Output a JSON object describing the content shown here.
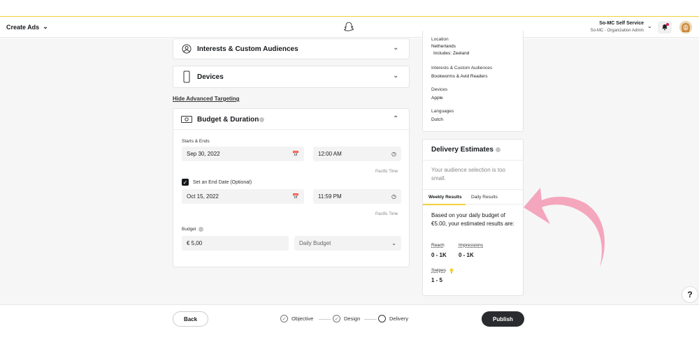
{
  "header": {
    "menu_label": "Create Ads",
    "account_name": "So-MC Self Service",
    "account_sub": "So-MC - Organization Admin"
  },
  "targeting": {
    "interests_title": "Interests & Custom Audiences",
    "devices_title": "Devices",
    "hide_link": "Hide Advanced Targeting"
  },
  "budget": {
    "title": "Budget & Duration",
    "starts_label": "Starts & Ends",
    "start_date": "Sep 30, 2022",
    "start_time": "12:00 AM",
    "timezone": "Pacific Time",
    "end_checkbox_label": "Set an End Date (Optional)",
    "end_date": "Oct 15, 2022",
    "end_time": "11:59 PM",
    "budget_label": "Budget",
    "budget_value": "€ 5,00",
    "budget_type": "Daily Budget"
  },
  "summary": {
    "location_label": "Location",
    "location_value": "Netherlands",
    "location_includes": "Includes: Zeeland",
    "interests_label": "Interests & Custom Audiences",
    "interests_value": "Bookworms & Avid Readers",
    "devices_label": "Devices",
    "devices_value": "Apple",
    "languages_label": "Languages",
    "languages_value": "Dutch"
  },
  "estimates": {
    "title": "Delivery Estimates",
    "warning": "Your audience selection is too small.",
    "tab_weekly": "Weekly Results",
    "tab_daily": "Daily Results",
    "intro": "Based on your daily budget of €5.00, your estimated results are:",
    "reach_label": "Reach",
    "reach_value": "0 - 1K",
    "impressions_label": "Impressions",
    "impressions_value": "0 - 1K",
    "swipes_label": "Swipes",
    "swipes_value": "1 - 5"
  },
  "footer": {
    "back": "Back",
    "steps": [
      "Objective",
      "Design",
      "Delivery"
    ],
    "publish": "Publish"
  },
  "colors": {
    "accent_yellow": "#f2d03b",
    "publish_bg": "#2a2b2e",
    "annotation_arrow": "#f4a6bd"
  }
}
